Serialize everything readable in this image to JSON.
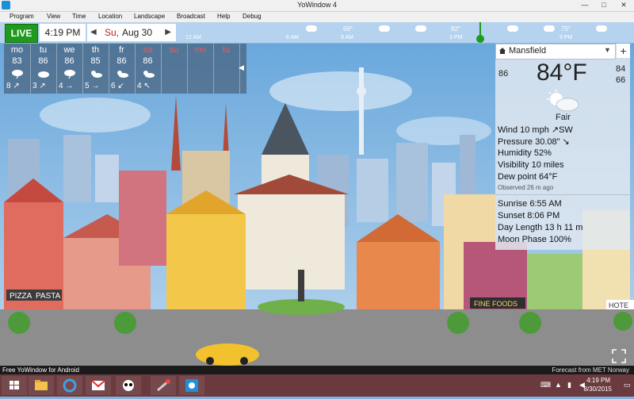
{
  "window": {
    "title": "YoWindow 4",
    "min": "—",
    "max": "□",
    "close": "✕"
  },
  "menu": [
    "Program",
    "View",
    "Time",
    "Location",
    "Landscape",
    "Broadcast",
    "Help",
    "Debug"
  ],
  "timebar": {
    "live": "LIVE",
    "time": "4:19 PM",
    "day": "Su,",
    "date": "Aug 30",
    "labels": [
      "12 AM",
      "6 AM",
      "9 AM",
      "3 PM",
      "9 PM"
    ],
    "temps": [
      "69°",
      "82°",
      "75°"
    ],
    "prev_icon": "chevron-left-icon",
    "next_icon": "chevron-right-icon"
  },
  "forecast": {
    "days": [
      {
        "day": "mo",
        "hi": "83",
        "icon": "thunderstorm-icon",
        "wind": "8 ↗"
      },
      {
        "day": "tu",
        "hi": "86",
        "icon": "cloudy-icon",
        "wind": "3 ↗"
      },
      {
        "day": "we",
        "hi": "86",
        "icon": "thunderstorm-icon",
        "wind": "4 →"
      },
      {
        "day": "th",
        "hi": "85",
        "icon": "partly-cloudy-icon",
        "wind": "5 →"
      },
      {
        "day": "fr",
        "hi": "86",
        "icon": "partly-cloudy-icon",
        "wind": "6 ↙"
      },
      {
        "day": "sa",
        "hi": "86",
        "icon": "partly-cloudy-icon",
        "wind": "4 ↖"
      },
      {
        "day": "su",
        "hi": "",
        "icon": "",
        "wind": ""
      },
      {
        "day": "mo",
        "hi": "",
        "icon": "",
        "wind": ""
      },
      {
        "day": "tu",
        "hi": "",
        "icon": "",
        "wind": ""
      }
    ],
    "weekend_color": "#e06060",
    "collapse": "◀"
  },
  "station": {
    "location": "Mansfield",
    "dropdown": "▼",
    "add": "+",
    "feels_like": "86",
    "temperature": "84°F",
    "high": "84",
    "low": "66",
    "condition": "Fair",
    "stats": [
      "Wind  10 mph ↗SW",
      "Pressure  30.08\" ↘",
      "Humidity  52%",
      "Visibility  10 miles",
      "Dew point  64°F"
    ],
    "observed": "Observed  26 m ago",
    "astro": [
      "Sunrise  6:55 AM",
      "Sunset  8:06 PM",
      "Day Length  13 h 11 m",
      "Moon Phase  100%"
    ]
  },
  "scene": {
    "signs": {
      "pizza": "PIZZA",
      "pasta": "PASTA",
      "fine_foods": "FINE FOODS",
      "hotel": "HOTE"
    }
  },
  "bottom": {
    "promo": "Free YoWindow for Android",
    "credit": "Forecast from MET Norway"
  },
  "taskbar": {
    "time": "4:19 PM",
    "date": "8/30/2015",
    "apps": [
      "windows-start-icon",
      "file-explorer-icon",
      "internet-explorer-icon",
      "gmail-icon",
      "panda-icon",
      "tool-icon",
      "yowindow-icon"
    ]
  },
  "colors": {
    "live": "#1f9a1f",
    "sky": "#7fb3e0",
    "taskbar": "#6b3a3e"
  }
}
